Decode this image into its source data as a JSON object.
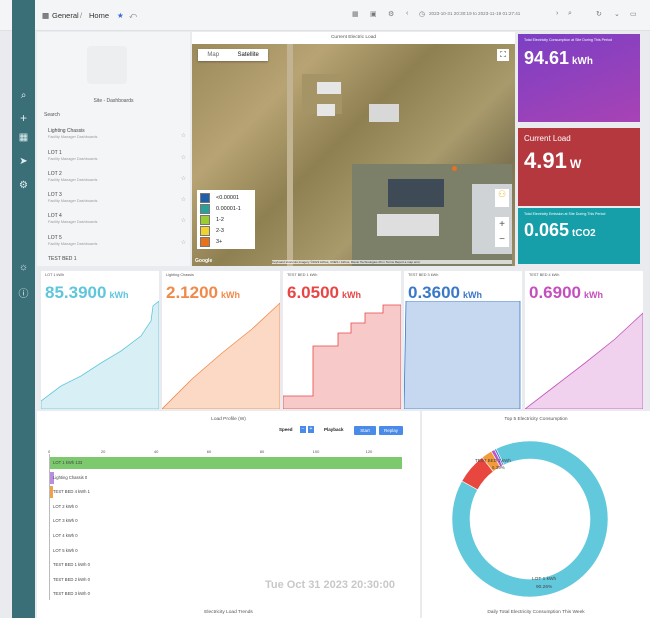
{
  "breadcrumb": {
    "home_label": "General",
    "sep": "/",
    "page_label": "Home"
  },
  "timerange": "2023-10-31 20:30:19 to 2023-11-19 01:27:41",
  "sidebar_panel": {
    "title": "Site - Dashboards",
    "search_label": "Search",
    "items": [
      {
        "title": "Lighting Chassis",
        "sub": "Facility Manager Dashboards"
      },
      {
        "title": "LOT 1",
        "sub": "Facility Manager Dashboards"
      },
      {
        "title": "LOT 2",
        "sub": "Facility Manager Dashboards"
      },
      {
        "title": "LOT 3",
        "sub": "Facility Manager Dashboards"
      },
      {
        "title": "LOT 4",
        "sub": "Facility Manager Dashboards"
      },
      {
        "title": "LOT 5",
        "sub": "Facility Manager Dashboards"
      },
      {
        "title": "TEST BED 1",
        "sub": ""
      }
    ]
  },
  "map": {
    "title": "Current Electric Load",
    "tab_map": "Map",
    "tab_satellite": "Satellite",
    "legend": [
      {
        "label": "<0.00001",
        "color": "#1f5fa8"
      },
      {
        "label": "0.00001-1",
        "color": "#2aa198"
      },
      {
        "label": "1-2",
        "color": "#9acd32"
      },
      {
        "label": "2-3",
        "color": "#f2d22e"
      },
      {
        "label": "3+",
        "color": "#e8711c"
      }
    ],
    "google": "Google",
    "attribution": "Keyboard shortcuts  Imagery ©2023 Airbus, CNES / Airbus, Maxar Technologies  20 m  Terms  Report a map error",
    "zoom_in": "+",
    "zoom_out": "−"
  },
  "stats": [
    {
      "label": "Total Electricity Consumption at Site During This Period",
      "value": "94.61",
      "unit": "kWh",
      "color": "#8c3ab8"
    },
    {
      "label": "Current Load",
      "value": "4.91",
      "unit": "W",
      "color": "#b5383f"
    },
    {
      "label": "Total Electricity Emission at Site During This Period",
      "value": "0.065",
      "unit": "tCO2",
      "color": "#169fa8"
    }
  ],
  "tiles": [
    {
      "label": "LOT 1 kWh",
      "value": "85.3900",
      "unit": "kWh",
      "color": "#5fc6dc",
      "fill": "#d8f0f5"
    },
    {
      "label": "Lighting Chassis",
      "value": "2.1200",
      "unit": "kWh",
      "color": "#f08a4b",
      "fill": "#fbd9c4"
    },
    {
      "label": "TEST BED 1 kWh",
      "value": "6.0500",
      "unit": "kWh",
      "color": "#e84545",
      "fill": "#f8c9c9"
    },
    {
      "label": "TEST BED 3 kWh",
      "value": "0.3600",
      "unit": "kWh",
      "color": "#3a78c8",
      "fill": "#c5d8f0"
    },
    {
      "label": "TEST BED 4 kWh",
      "value": "0.6900",
      "unit": "kWh",
      "color": "#c44fbf",
      "fill": "#f0d2ee"
    }
  ],
  "load_profile": {
    "title": "Load Profile (W)",
    "speed_label": "Speed",
    "playback_label": "Playback",
    "start_label": "Start",
    "replay_label": "Replay",
    "timestamp": "Tue Oct 31 2023 20:30:00",
    "bottom_title": "Electricity Load Trends",
    "ticks": [
      "0",
      "20",
      "40",
      "60",
      "80",
      "100",
      "120"
    ],
    "bars": [
      {
        "label": "LOT 1 kWh 133",
        "value": 133,
        "color": "#7cc96e"
      },
      {
        "label": "Lighting Chassis 0",
        "value": 0,
        "color": "#b98de0"
      },
      {
        "label": "TEST BED 4 kWh 1",
        "value": 1,
        "color": "#f0a24b"
      },
      {
        "label": "LOT 2 kWh 0",
        "value": 0,
        "color": "#cccccc"
      },
      {
        "label": "LOT 3 kWh 0",
        "value": 0,
        "color": "#cccccc"
      },
      {
        "label": "LOT 4 kWh 0",
        "value": 0,
        "color": "#cccccc"
      },
      {
        "label": "LOT 5 kWh 0",
        "value": 0,
        "color": "#cccccc"
      },
      {
        "label": "TEST BED 1 kWh 0",
        "value": 0,
        "color": "#cccccc"
      },
      {
        "label": "TEST BED 2 kWh 0",
        "value": 0,
        "color": "#cccccc"
      },
      {
        "label": "TEST BED 3 kWh 0",
        "value": 0,
        "color": "#cccccc"
      }
    ]
  },
  "donut": {
    "title": "Top 5 Electricity Consumption",
    "bottom_title": "Daily Total Electricity Consumption This Week",
    "slices": [
      {
        "label": "LOT 1 kWh",
        "pct": 90.26,
        "color": "#62c8dc"
      },
      {
        "label": "TEST BED 1 kWh",
        "pct": 6.4,
        "color": "#e8473f"
      },
      {
        "label": "Lighting Chassis",
        "pct": 2.24,
        "color": "#f29a3c"
      },
      {
        "label": "TEST BED 4 kWh",
        "pct": 0.73,
        "color": "#c056c4"
      },
      {
        "label": "TEST BED 3 kWh",
        "pct": 0.37,
        "color": "#3d7ad0"
      }
    ],
    "lot1_label": "LOT 1 kWh",
    "lot1_pct": "90.26%",
    "tb1_label": "TEST BED 1 kWh",
    "tb1_pct": "6.39%"
  }
}
